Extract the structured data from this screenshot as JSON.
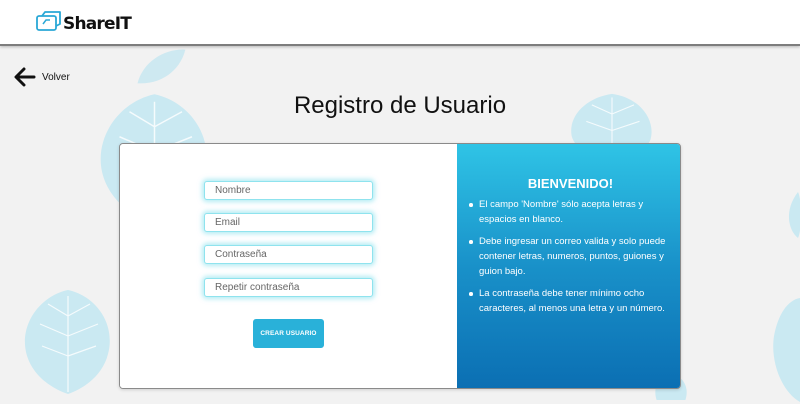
{
  "header": {
    "logo_text": "ShareIT",
    "icon": "share-logo-icon"
  },
  "nav": {
    "back_label": "Volver",
    "back_icon": "arrow-left-icon"
  },
  "page": {
    "title": "Registro de Usuario"
  },
  "form": {
    "name_placeholder": "Nombre",
    "email_placeholder": "Email",
    "password_placeholder": "Contraseña",
    "repeat_password_placeholder": "Repetir contraseña",
    "submit_label": "CREAR USUARIO"
  },
  "info": {
    "title": "BIENVENIDO!",
    "items": [
      "El campo 'Nombre' sólo acepta letras y espacios en blanco.",
      "Debe ingresar un correo valida y solo puede contener letras, numeros, puntos, guiones y guion bajo.",
      "La contraseña debe tener mínimo ocho caracteres, al menos una letra y un número."
    ]
  },
  "colors": {
    "accent": "#29b1d9",
    "gradient_top": "#2fc4e6",
    "gradient_bottom": "#0b6fb3",
    "background": "#f2f2f2",
    "leaf": "#bfe6f1"
  }
}
